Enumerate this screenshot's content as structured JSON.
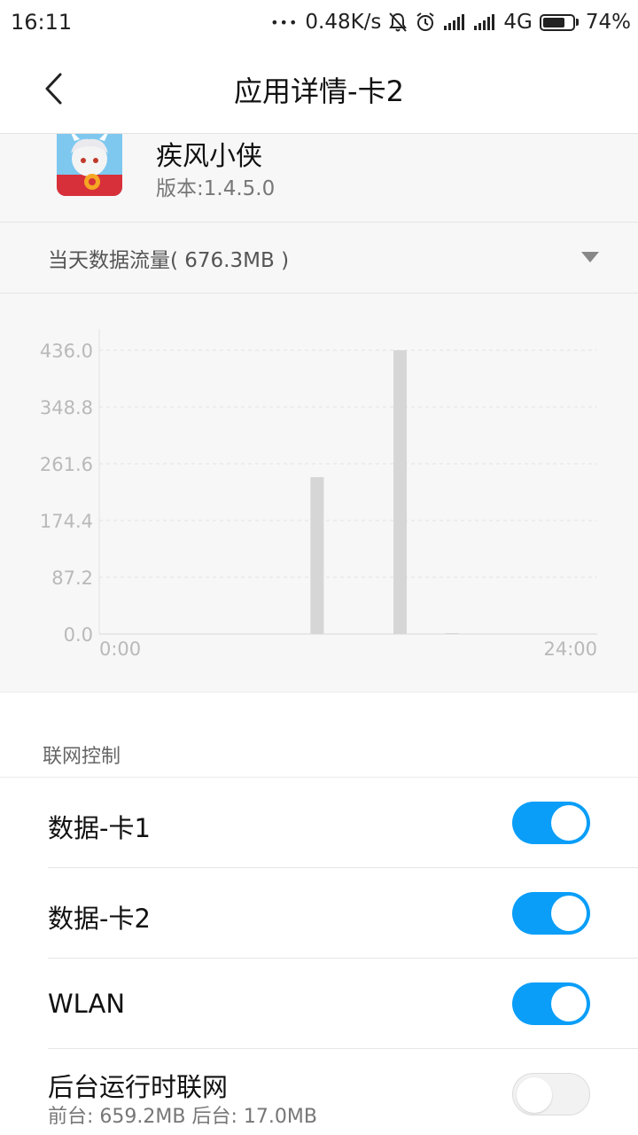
{
  "status_bar": {
    "time": "16:11",
    "dots": "•••",
    "net_speed": "0.48K/s",
    "network": "4G",
    "battery": "74%",
    "battery_level": 0.74,
    "icons": [
      "more-dots-icon",
      "mute-bell-icon",
      "alarm-icon",
      "signal-icon",
      "signal-icon",
      "battery-icon"
    ]
  },
  "header": {
    "title": "应用详情-卡2",
    "back_icon": "chevron-left-icon"
  },
  "app": {
    "name": "疾风小侠",
    "version": "版本:1.4.5.0"
  },
  "usage": {
    "label": "当天数据流量( 676.3MB )",
    "dropdown_icon": "triangle-down-icon"
  },
  "chart_data": {
    "type": "bar",
    "x_start_label": "0:00",
    "x_end_label": "24:00",
    "x_range": [
      0,
      24
    ],
    "y_ticks": [
      "436.0",
      "348.8",
      "261.6",
      "174.4",
      "87.2",
      "0.0"
    ],
    "ylim": [
      0,
      436.0
    ],
    "bars": [
      {
        "hour": 10.5,
        "value": 241
      },
      {
        "hour": 14.5,
        "value": 436
      },
      {
        "hour": 17.0,
        "value": 1
      }
    ],
    "grid": true,
    "bar_color": "#d6d6d6"
  },
  "network_control": {
    "header": "联网控制",
    "rows": [
      {
        "label": "数据-卡1",
        "enabled": true
      },
      {
        "label": "数据-卡2",
        "enabled": true
      },
      {
        "label": "WLAN",
        "enabled": true
      },
      {
        "label": "后台运行时联网",
        "sub": "前台: 659.2MB   后台: 17.0MB",
        "enabled": false
      }
    ]
  },
  "colors": {
    "accent": "#0a9ef8",
    "background": "#f7f7f7"
  }
}
